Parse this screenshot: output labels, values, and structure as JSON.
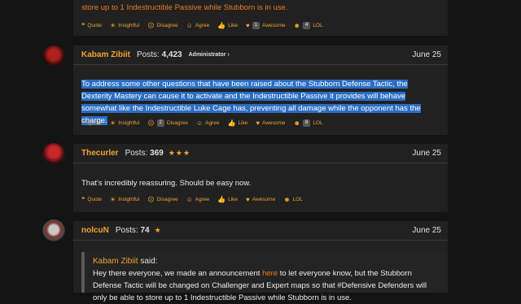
{
  "top_post": {
    "text": "store up to 1 Indestructible Passive while Stubborn is in use.",
    "reactions": [
      {
        "icon": "quote-icon",
        "label": "Quote"
      },
      {
        "icon": "lightbulb-icon",
        "label": "Insightful"
      },
      {
        "icon": "disagree-icon",
        "label": "Disagree"
      },
      {
        "icon": "agree-icon",
        "label": "Agree"
      },
      {
        "icon": "like-icon",
        "label": "Like"
      },
      {
        "icon": "heart-icon",
        "label": "Awesome",
        "count": "1"
      },
      {
        "icon": "lol-icon",
        "label": "LOL",
        "count": "4"
      }
    ]
  },
  "posts": [
    {
      "author": "Kabam Zibiit",
      "posts_label": "Posts:",
      "posts_count": "4,423",
      "role": "Administrator ›",
      "date": "June 25",
      "text": "To address some other questions that have been raised about the Stubborn Defense Tactic, the Dexterity Mastery can cause it to activate and the Indestructible Passive it provides will behave somewhat like the Indestructible Luke Cage has, preventing all damage while the opponent has the charge.",
      "reactions": [
        {
          "icon": "quote-icon",
          "label": "Quote"
        },
        {
          "icon": "lightbulb-icon",
          "label": "Insightful"
        },
        {
          "icon": "disagree-icon",
          "label": "Disagree",
          "count": "2"
        },
        {
          "icon": "agree-icon",
          "label": "Agree"
        },
        {
          "icon": "like-icon",
          "label": "Like"
        },
        {
          "icon": "heart-icon",
          "label": "Awesome"
        },
        {
          "icon": "lol-icon",
          "label": "LOL",
          "count": "8"
        }
      ]
    },
    {
      "author": "Thecurler",
      "posts_label": "Posts:",
      "posts_count": "369",
      "stars": "★★★",
      "date": "June 25",
      "text": "That's incredibly reassuring. Should be easy now.",
      "reactions": [
        {
          "icon": "quote-icon",
          "label": "Quote"
        },
        {
          "icon": "lightbulb-icon",
          "label": "Insightful"
        },
        {
          "icon": "disagree-icon",
          "label": "Disagree"
        },
        {
          "icon": "agree-icon",
          "label": "Agree"
        },
        {
          "icon": "like-icon",
          "label": "Like"
        },
        {
          "icon": "heart-icon",
          "label": "Awesome"
        },
        {
          "icon": "lol-icon",
          "label": "LOL"
        }
      ]
    },
    {
      "author": "nolcuN",
      "posts_label": "Posts:",
      "posts_count": "74",
      "stars": "★",
      "date": "June 25",
      "quote_author": "Kabam Zibiit",
      "quote_said": "said:",
      "quote_text_1": "Hey there everyone, we made an announcement ",
      "quote_link": "here",
      "quote_text_2": " to let everyone know, but the Stubborn Defense Tactic will be changed on Challenger and Expert maps so that #Defensive Defenders will only be able to store up to 1 Indestructible Passive while Stubborn is in use."
    }
  ]
}
